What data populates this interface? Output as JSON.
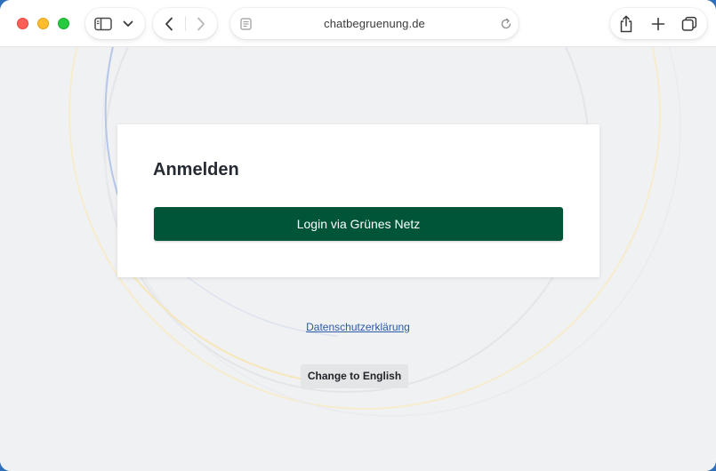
{
  "browser": {
    "url": "chatbegruenung.de",
    "icons": {
      "sidebar": "sidebar-icon",
      "sidebar_menu": "chevron-down-icon",
      "back": "chevron-left-icon",
      "forward": "chevron-right-icon",
      "reader": "reader-icon",
      "reload": "reload-icon",
      "share": "share-icon",
      "new_tab": "plus-icon",
      "tabs": "tab-overview-icon"
    }
  },
  "login": {
    "title": "Anmelden",
    "button_label": "Login via Grünes Netz"
  },
  "footer": {
    "privacy_link": "Datenschutzerklärung",
    "language_button": "Change to English"
  },
  "colors": {
    "primary_button": "#005538",
    "link": "#2a5aa8",
    "page_background": "#f0f1f3"
  }
}
